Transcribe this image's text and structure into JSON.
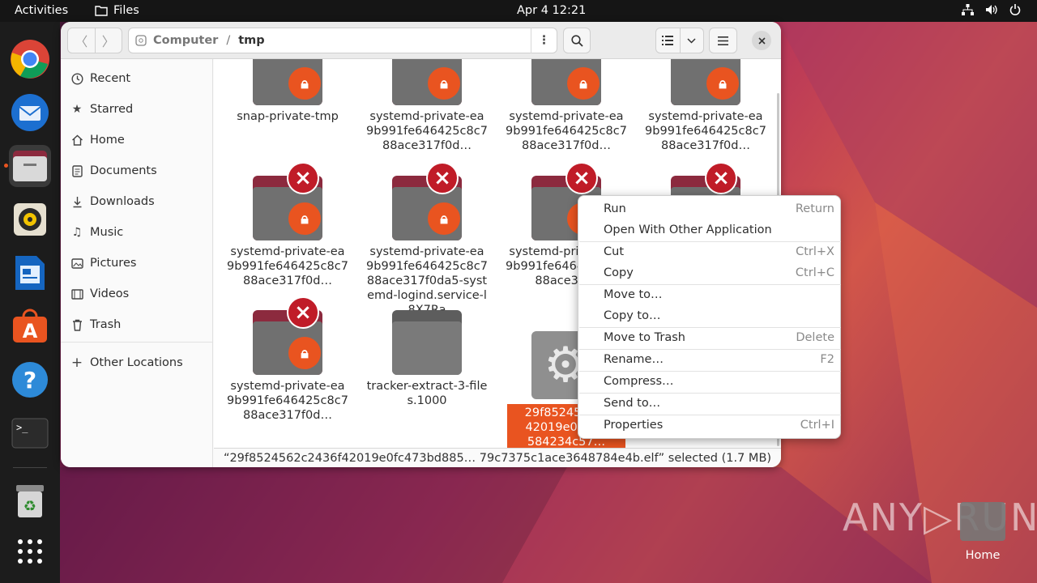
{
  "topbar": {
    "activities": "Activities",
    "app_name": "Files",
    "clock": "Apr 4  12:21"
  },
  "dock": {
    "items": [
      "chrome-icon",
      "thunderbird-icon",
      "files-icon",
      "rhythmbox-icon",
      "libreoffice-writer-icon",
      "app-center-icon",
      "help-icon",
      "terminal-icon",
      "trash-icon",
      "show-apps-icon"
    ]
  },
  "path": {
    "root": "Computer",
    "separator": "/",
    "current": "tmp"
  },
  "sidebar": {
    "items": [
      {
        "label": "Recent",
        "icon": "clock-icon"
      },
      {
        "label": "Starred",
        "icon": "star-icon"
      },
      {
        "label": "Home",
        "icon": "home-icon"
      },
      {
        "label": "Documents",
        "icon": "document-icon"
      },
      {
        "label": "Downloads",
        "icon": "download-icon"
      },
      {
        "label": "Music",
        "icon": "music-icon"
      },
      {
        "label": "Pictures",
        "icon": "picture-icon"
      },
      {
        "label": "Videos",
        "icon": "video-icon"
      },
      {
        "label": "Trash",
        "icon": "trash-icon"
      }
    ],
    "other": "Other Locations"
  },
  "files": [
    {
      "name": "snap-private-tmp"
    },
    {
      "name": "systemd-private-ea9b991fe646425c8c788ace317f0d…"
    },
    {
      "name": "systemd-private-ea9b991fe646425c8c788ace317f0d…"
    },
    {
      "name": "systemd-private-ea9b991fe646425c8c788ace317f0d…"
    },
    {
      "name": "systemd-private-ea9b991fe646425c8c788ace317f0d…"
    },
    {
      "name": "systemd-private-ea9b991fe646425c8c788ace317f0da5-systemd-logind.service-l8X7Ra"
    },
    {
      "name": "systemd-private-ea9b991fe646425c8c788ace31…"
    },
    {
      "name": ""
    },
    {
      "name": "systemd-private-ea9b991fe646425c8c788ace317f0d…"
    },
    {
      "name": "tracker-extract-3-files.1000"
    },
    {
      "name": "29f8524562…42019e0fc4…584234c57…75c1ace36…4b.elf"
    }
  ],
  "status": "“29f8524562c2436f42019e0fc473bd885…  79c7375c1ace3648784e4b.elf” selected (1.7 MB)",
  "context_menu": {
    "items": [
      {
        "label": "Run",
        "accel": "Return"
      },
      {
        "label": "Open With Other Application",
        "accel": ""
      },
      {
        "label": "Cut",
        "accel": "Ctrl+X"
      },
      {
        "label": "Copy",
        "accel": "Ctrl+C"
      },
      {
        "label": "Move to…",
        "accel": ""
      },
      {
        "label": "Copy to…",
        "accel": ""
      },
      {
        "label": "Move to Trash",
        "accel": "Delete"
      },
      {
        "label": "Rename…",
        "accel": "F2"
      },
      {
        "label": "Compress…",
        "accel": ""
      },
      {
        "label": "Send to…",
        "accel": ""
      },
      {
        "label": "Properties",
        "accel": "Ctrl+I"
      }
    ]
  },
  "desktop": {
    "home_label": "Home",
    "watermark": "ANY▷RUN"
  },
  "colors": {
    "accent": "#e95420",
    "danger": "#c01c28",
    "folder_gray": "#707070"
  }
}
